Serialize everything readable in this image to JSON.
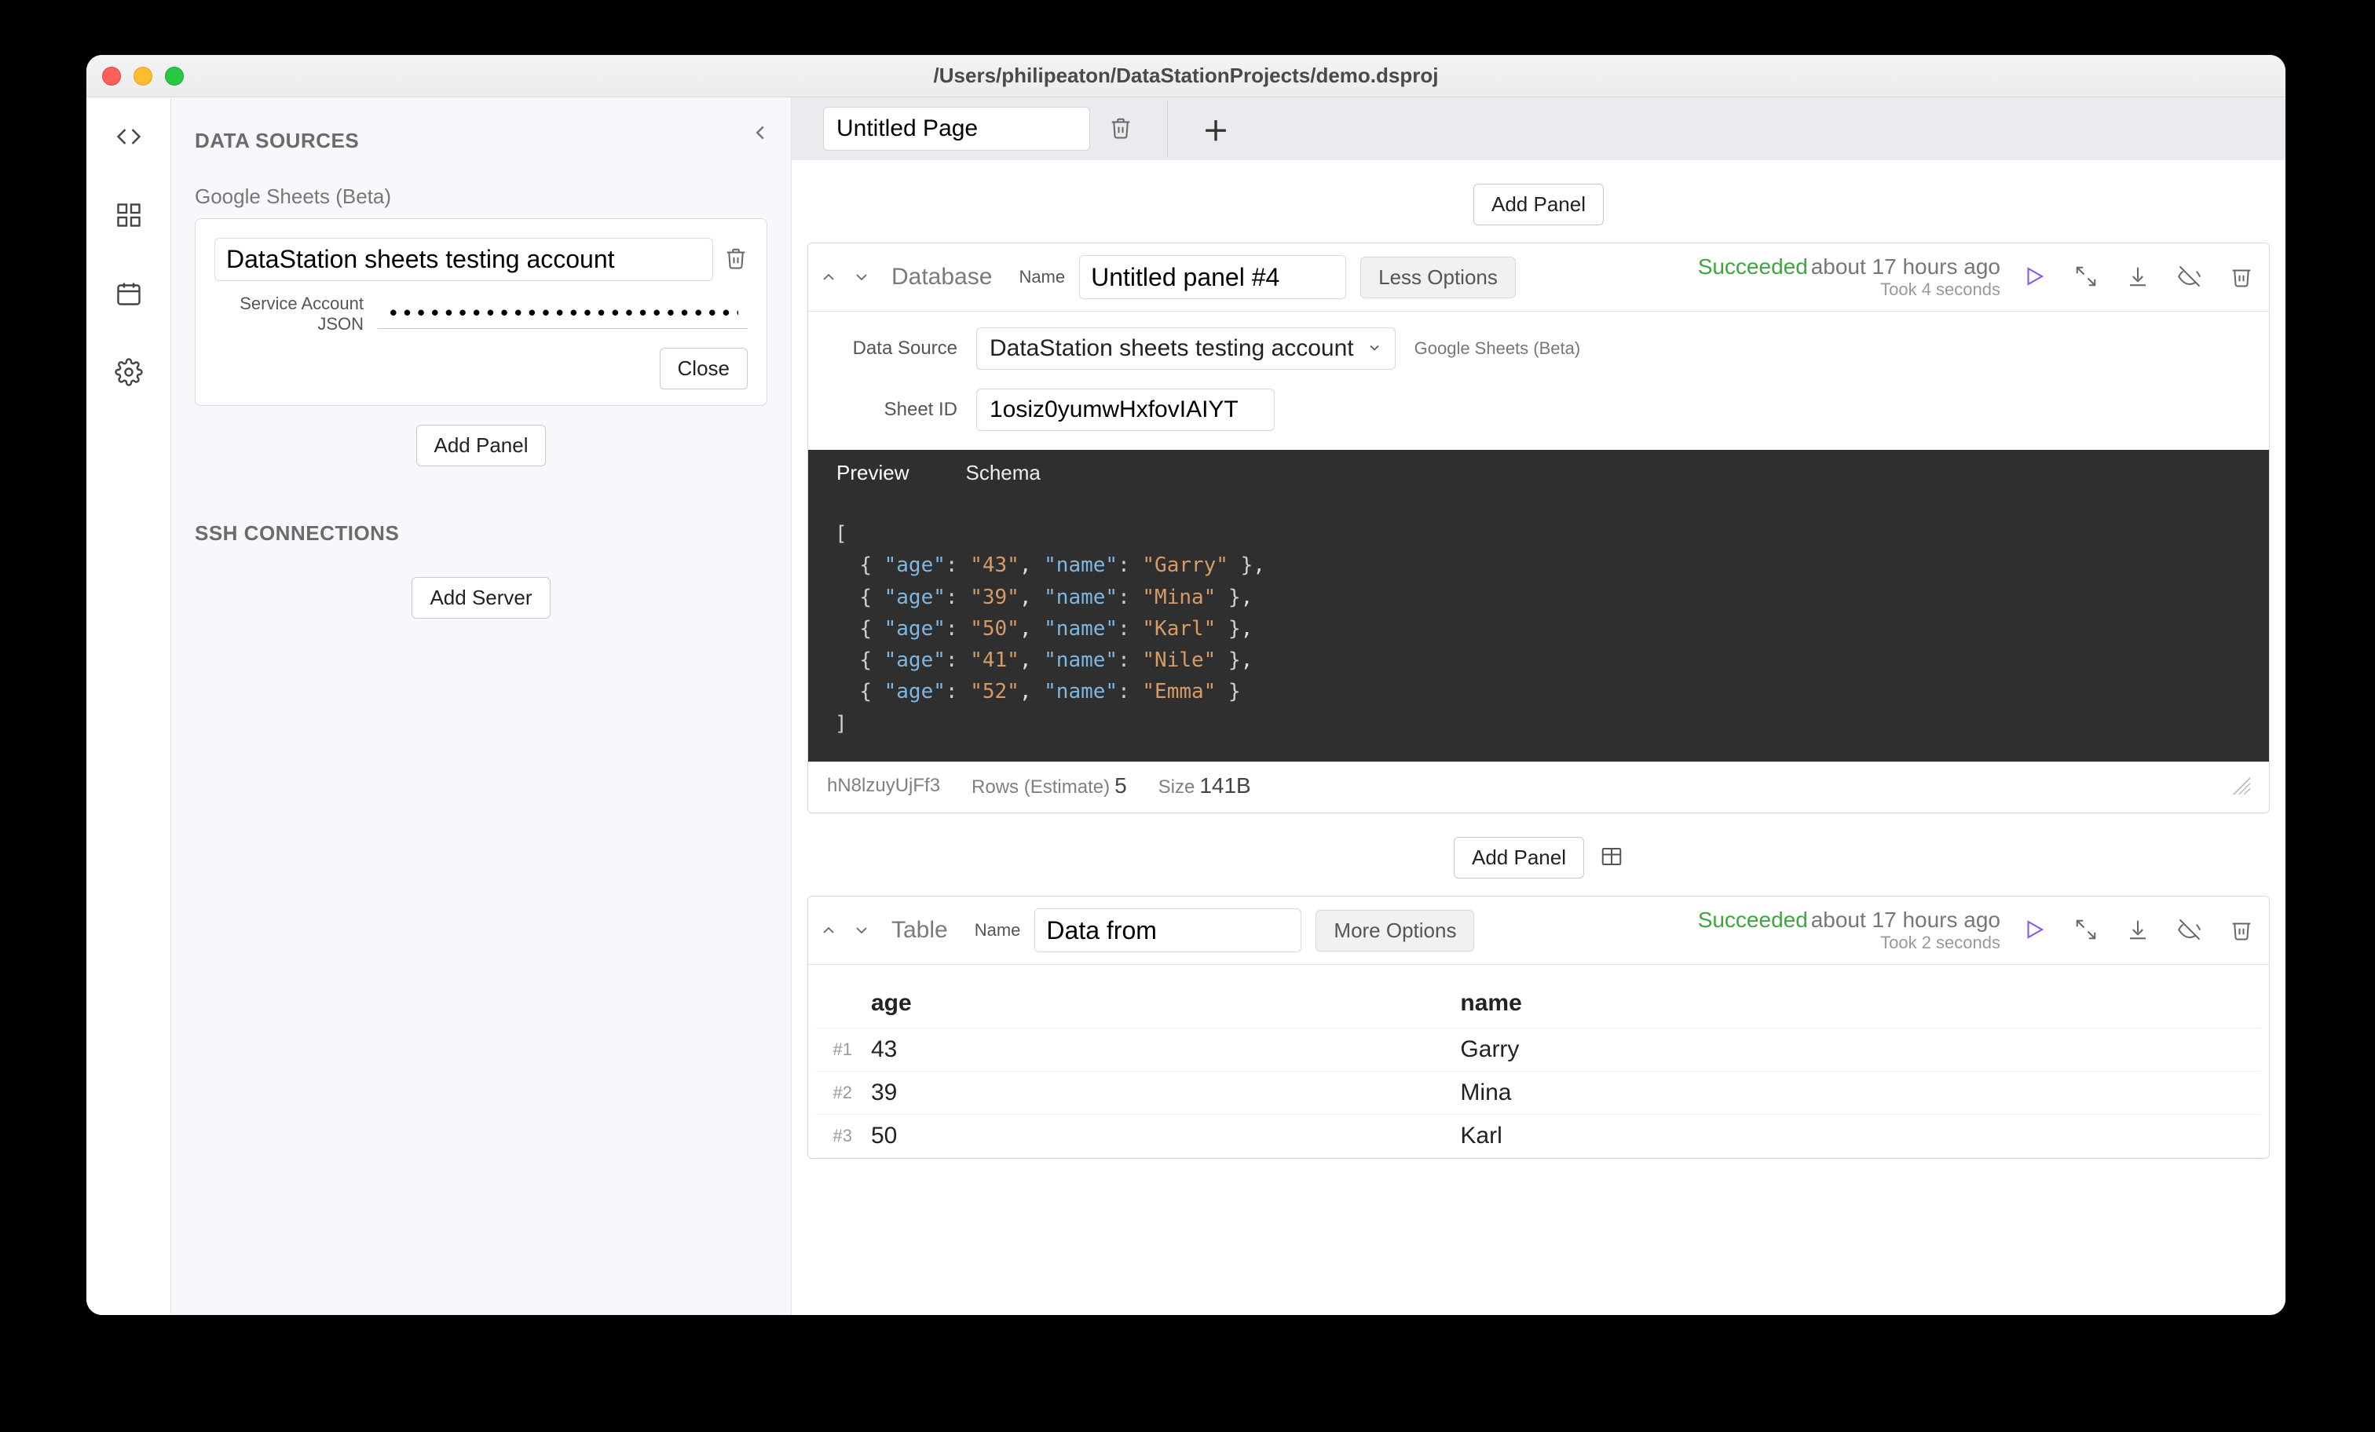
{
  "window": {
    "title": "/Users/philipeaton/DataStationProjects/demo.dsproj"
  },
  "sidebar": {
    "section1_title": "DATA SOURCES",
    "source_type_label": "Google Sheets (Beta)",
    "source": {
      "name": "DataStation sheets testing account",
      "service_field_label": "Service Account JSON",
      "service_field_value": "••••••••••••••••••••••••••••••••",
      "close_label": "Close"
    },
    "add_panel_label": "Add Panel",
    "section2_title": "SSH CONNECTIONS",
    "add_server_label": "Add Server"
  },
  "tabs": {
    "page_name": "Untitled Page"
  },
  "toolbar": {
    "add_panel_label": "Add Panel"
  },
  "panel1": {
    "type_label": "Database",
    "name_label": "Name",
    "name_value": "Untitled panel #4",
    "options_label": "Less Options",
    "status_word": "Succeeded",
    "status_time": "about 17 hours ago",
    "status_took": "Took 4 seconds",
    "datasource_label": "Data Source",
    "datasource_value": "DataStation sheets testing account",
    "datasource_type": "Google Sheets (Beta)",
    "sheetid_label": "Sheet ID",
    "sheetid_value": "1osiz0yumwHxfovIAIYT",
    "tab_preview": "Preview",
    "tab_schema": "Schema",
    "preview_rows": [
      {
        "age": "43",
        "name": "Garry"
      },
      {
        "age": "39",
        "name": "Mina"
      },
      {
        "age": "50",
        "name": "Karl"
      },
      {
        "age": "41",
        "name": "Nile"
      },
      {
        "age": "52",
        "name": "Emma"
      }
    ],
    "meta_id": "hN8lzuyUjFf3",
    "meta_rows_label": "Rows (Estimate)",
    "meta_rows_value": "5",
    "meta_size_label": "Size",
    "meta_size_value": "141B"
  },
  "panel2": {
    "type_label": "Table",
    "name_label": "Name",
    "name_value": "Data from",
    "options_label": "More Options",
    "status_word": "Succeeded",
    "status_time": "about 17 hours ago",
    "status_took": "Took 2 seconds",
    "columns": [
      "age",
      "name"
    ],
    "rows": [
      {
        "idx": "#1",
        "age": "43",
        "name": "Garry"
      },
      {
        "idx": "#2",
        "age": "39",
        "name": "Mina"
      },
      {
        "idx": "#3",
        "age": "50",
        "name": "Karl"
      }
    ]
  }
}
